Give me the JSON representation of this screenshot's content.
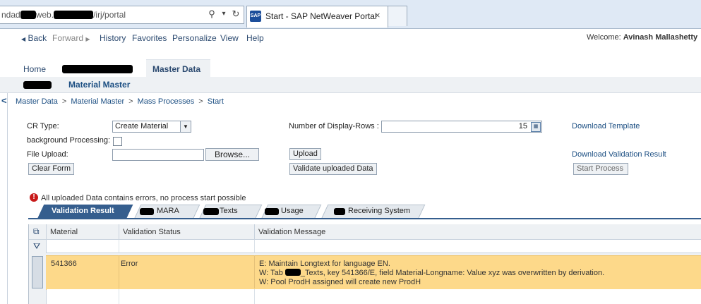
{
  "browser": {
    "address_prefix": "ndad",
    "address_mid": "web.",
    "address_suffix": "/irj/portal",
    "tab_favicon": "SAP",
    "tab_title": "Start - SAP NetWeaver Portal",
    "close_glyph": "×",
    "search_glyph": "⚲",
    "dropdown_glyph": "▾",
    "refresh_glyph": "↻"
  },
  "toolbar": {
    "back": "Back",
    "forward": "Forward",
    "history": "History",
    "favorites": "Favorites",
    "personalize": "Personalize",
    "view": "View",
    "help": "Help",
    "welcome_label": "Welcome:",
    "welcome_user": "Avinash Mallashetty"
  },
  "navigation": {
    "home": "Home",
    "master_data": "Master Data",
    "material_master": "Material Master"
  },
  "breadcrumb": [
    "Master Data",
    "Material Master",
    "Mass Processes",
    "Start"
  ],
  "breadcrumb_sep": ">",
  "form": {
    "cr_type_label": "CR Type:",
    "cr_type_value": "Create Material",
    "bg_processing_label": "background Processing:",
    "file_upload_label": "File Upload:",
    "browse": "Browse...",
    "clear_form": "Clear Form",
    "display_rows_label": "Number of Display-Rows :",
    "display_rows_value": "15",
    "upload": "Upload",
    "validate": "Validate uploaded Data",
    "download_template": "Download Template",
    "download_validation": "Download Validation Result",
    "start_process": "Start Process"
  },
  "error_message": "All uploaded Data contains errors, no process start possible",
  "result_tabs": [
    "Validation Result",
    "MARA",
    "Texts",
    "Usage",
    "Receiving System"
  ],
  "table": {
    "columns": [
      "Material",
      "Validation Status",
      "Validation Message"
    ],
    "rows": [
      {
        "material": "541366",
        "status": "Error",
        "message_1": "E: Maintain Longtext for language EN.",
        "message_2a": "W: Tab",
        "message_2b": "_Texts, key 541366/E, field Material-Longname: Value xyz was overwritten by derivation.",
        "message_3": "W: Pool ProdH assigned will create new ProdH"
      }
    ]
  }
}
